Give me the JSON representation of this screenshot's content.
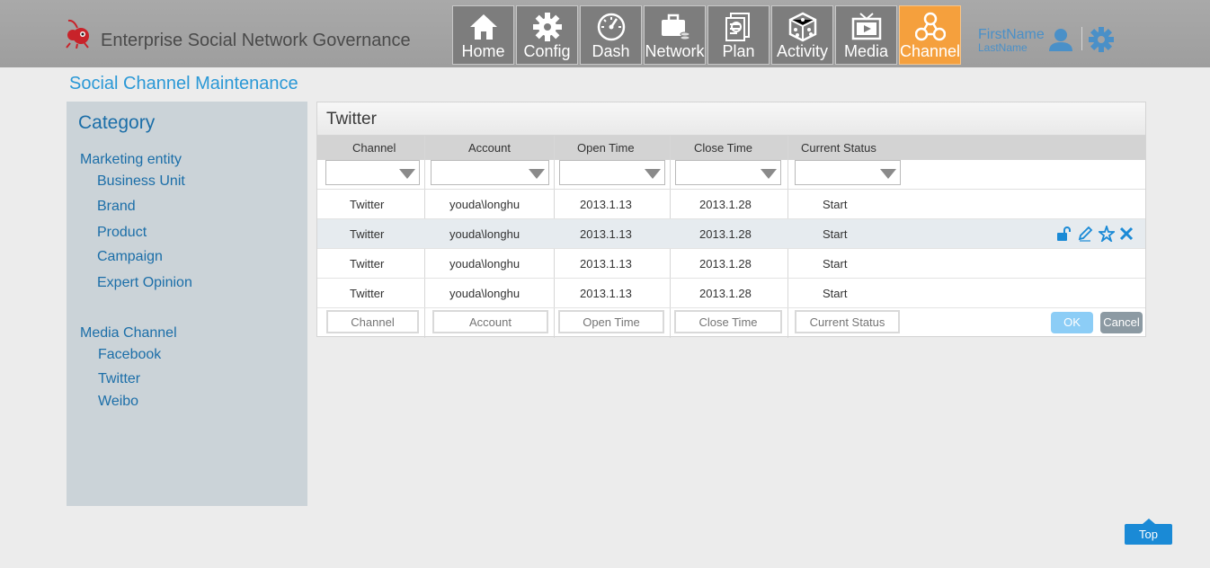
{
  "header": {
    "app_title": "Enterprise Social Network Governance",
    "nav": [
      {
        "label": "Home",
        "icon": "home-icon"
      },
      {
        "label": "Config",
        "icon": "gear-icon"
      },
      {
        "label": "Dash",
        "icon": "gauge-icon"
      },
      {
        "label": "Network",
        "icon": "briefcase-icon"
      },
      {
        "label": "Plan",
        "icon": "document-search-icon"
      },
      {
        "label": "Activity",
        "icon": "dice-icon"
      },
      {
        "label": "Media",
        "icon": "tv-icon"
      },
      {
        "label": "Channel",
        "icon": "channel-network-icon",
        "active": true
      }
    ],
    "user": {
      "first_name": "FirstName",
      "last_name": "LastName"
    }
  },
  "page_title": "Social Channel Maintenance",
  "sidebar": {
    "title": "Category",
    "groups": [
      {
        "label": "Marketing entity",
        "items": [
          "Business Unit",
          "Brand",
          "Product",
          "Campaign",
          "Expert Opinion"
        ]
      },
      {
        "label": "Media Channel",
        "items": [
          "Facebook",
          "Twitter",
          "Weibo"
        ]
      }
    ]
  },
  "panel": {
    "title": "Twitter",
    "columns": [
      "Channel",
      "Account",
      "Open Time",
      "Close Time",
      "Current Status"
    ],
    "rows": [
      [
        "Twitter",
        "youda\\longhu",
        "2013.1.13",
        "2013.1.28",
        "Start"
      ],
      [
        "Twitter",
        "youda\\longhu",
        "2013.1.13",
        "2013.1.28",
        "Start"
      ],
      [
        "Twitter",
        "youda\\longhu",
        "2013.1.13",
        "2013.1.28",
        "Start"
      ],
      [
        "Twitter",
        "youda\\longhu",
        "2013.1.13",
        "2013.1.28",
        "Start"
      ]
    ],
    "highlighted_row": 1,
    "row_actions": [
      "unlock-icon",
      "edit-icon",
      "star-icon",
      "delete-icon"
    ],
    "edit_placeholders": [
      "Channel",
      "Account",
      "Open Time",
      "Close Time",
      "Current Status"
    ],
    "ok_label": "OK",
    "cancel_label": "Cancel"
  },
  "top_label": "Top",
  "colors": {
    "accent": "#2a98d6",
    "active_nav": "#f5a03d",
    "nav_bg": "#7d7d7d",
    "sidebar_bg": "#cbd3d8"
  }
}
